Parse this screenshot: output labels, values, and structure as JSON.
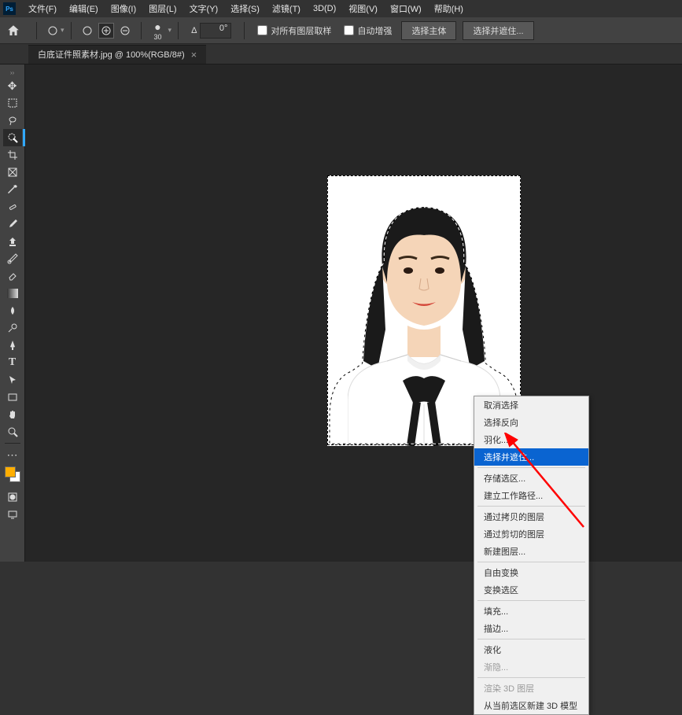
{
  "menubar": {
    "items": [
      "文件(F)",
      "编辑(E)",
      "图像(I)",
      "图层(L)",
      "文字(Y)",
      "选择(S)",
      "滤镜(T)",
      "3D(D)",
      "视图(V)",
      "窗口(W)",
      "帮助(H)"
    ]
  },
  "optbar": {
    "brush_size": "30",
    "angle_label": "Δ",
    "angle_value": "0°",
    "check1": "对所有图层取样",
    "check2": "自动增强",
    "btn1": "选择主体",
    "btn2": "选择并遮住..."
  },
  "tab": {
    "title": "白底证件照素材.jpg @ 100%(RGB/8#)",
    "close": "×"
  },
  "context_menu": {
    "items": [
      {
        "label": "取消选择",
        "disabled": false
      },
      {
        "label": "选择反向",
        "disabled": false
      },
      {
        "label": "羽化...",
        "disabled": false
      },
      {
        "label": "选择并遮住...",
        "disabled": false,
        "highlighted": true
      },
      {
        "sep": true
      },
      {
        "label": "存储选区...",
        "disabled": false
      },
      {
        "label": "建立工作路径...",
        "disabled": false
      },
      {
        "sep": true
      },
      {
        "label": "通过拷贝的图层",
        "disabled": false
      },
      {
        "label": "通过剪切的图层",
        "disabled": false
      },
      {
        "label": "新建图层...",
        "disabled": false
      },
      {
        "sep": true
      },
      {
        "label": "自由变换",
        "disabled": false
      },
      {
        "label": "变换选区",
        "disabled": false
      },
      {
        "sep": true
      },
      {
        "label": "填充...",
        "disabled": false
      },
      {
        "label": "描边...",
        "disabled": false
      },
      {
        "sep": true
      },
      {
        "label": "液化",
        "disabled": false
      },
      {
        "label": "渐隐...",
        "disabled": true
      },
      {
        "sep": true
      },
      {
        "label": "渲染 3D 图层",
        "disabled": true
      },
      {
        "label": "从当前选区新建 3D 模型",
        "disabled": false
      }
    ]
  }
}
